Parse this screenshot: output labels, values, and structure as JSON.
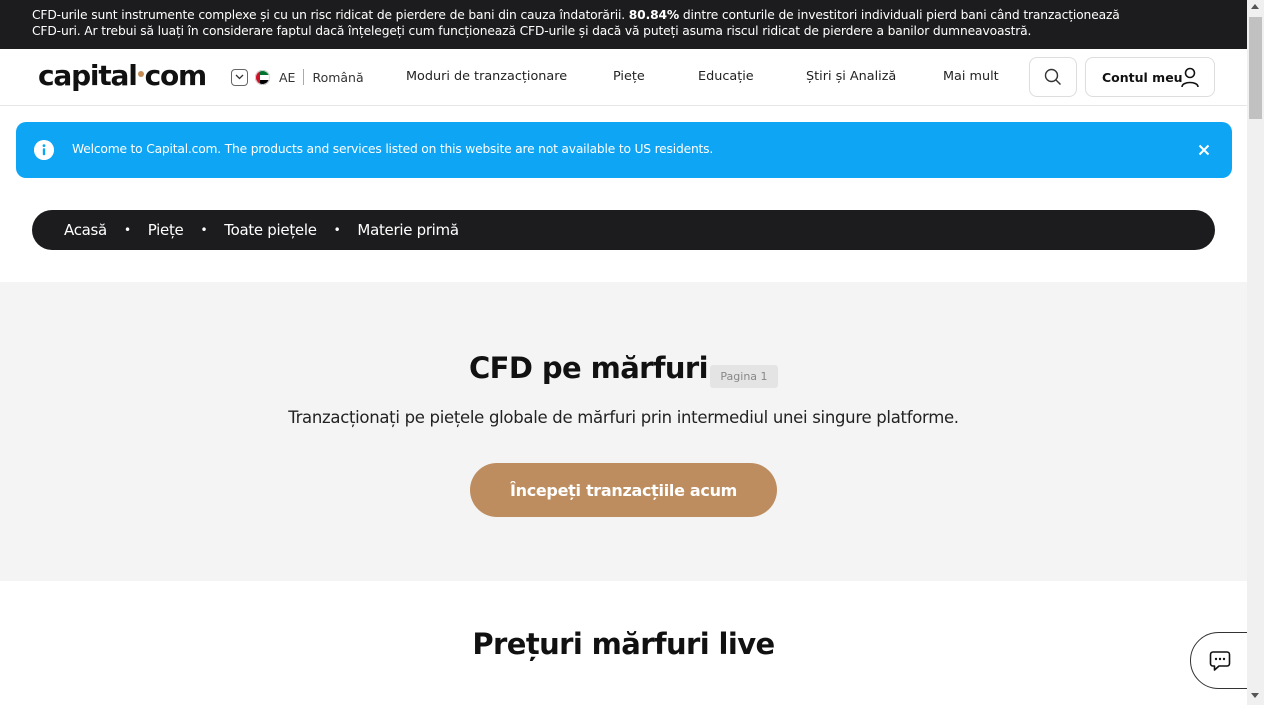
{
  "risk_warning": {
    "part1": "CFD-urile sunt instrumente complexe și cu un risc ridicat de pierdere de bani din cauza îndatorării. ",
    "percent": "80.84%",
    "part2": " dintre conturile de investitori individuali pierd bani când tranzacționează",
    "line2": "CFD-uri. Ar trebui să luați în considerare faptul dacă înțelegeți cum funcționează CFD-urile și dacă vă puteți asuma riscul ridicat de pierdere a banilor dumneavoastră."
  },
  "header": {
    "logo_left": "capital",
    "logo_right": "com",
    "region_code": "AE",
    "language": "Română",
    "nav": [
      "Moduri de tranzacționare",
      "Piețe",
      "Educație",
      "Știri și Analiză",
      "Mai mult"
    ],
    "account_label": "Contul meu"
  },
  "notice": {
    "text": "Welcome to Capital.com. The products and services listed on this website are not available to US residents."
  },
  "breadcrumb": [
    "Acasă",
    "Piețe",
    "Toate piețele",
    "Materie primă"
  ],
  "hero": {
    "title": "CFD pe mărfuri",
    "page_badge": "Pagina 1",
    "subtitle": "Tranzacționați pe piețele globale de mărfuri prin intermediul unei singure platforme.",
    "cta": "Începeți tranzacțiile acum"
  },
  "live_prices_title": "Prețuri mărfuri live",
  "colors": {
    "dark": "#1c1c1e",
    "notice_blue": "#0ea5f5",
    "cta_brown": "#bd8d5f",
    "hero_bg": "#f4f4f4"
  },
  "icons": {
    "region_toggle": "chevron-down-icon",
    "flag": "uae-flag-icon",
    "search": "search-icon",
    "account": "user-icon",
    "notice_info": "info-icon",
    "notice_close": "close-icon",
    "chat": "chat-icon"
  }
}
